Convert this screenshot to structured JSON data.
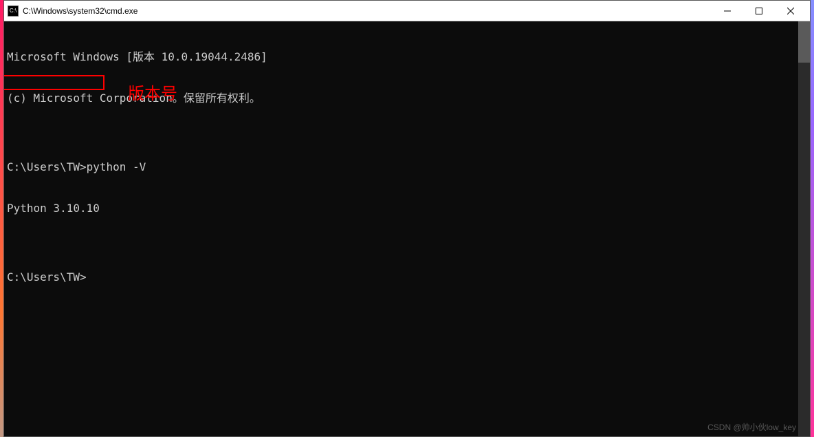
{
  "window": {
    "title": "C:\\Windows\\system32\\cmd.exe",
    "icon_label": "C:\\"
  },
  "terminal": {
    "line1": "Microsoft Windows [版本 10.0.19044.2486]",
    "line2": "(c) Microsoft Corporation。保留所有权利。",
    "line3": "",
    "prompt1_path": "C:\\Users\\TW>",
    "prompt1_command": "python -V",
    "output1": "Python 3.10.10",
    "line_blank": "",
    "prompt2_path": "C:\\Users\\TW>"
  },
  "annotation": {
    "label": "版本号"
  },
  "watermark": {
    "text": "CSDN @帅小伙low_key"
  }
}
